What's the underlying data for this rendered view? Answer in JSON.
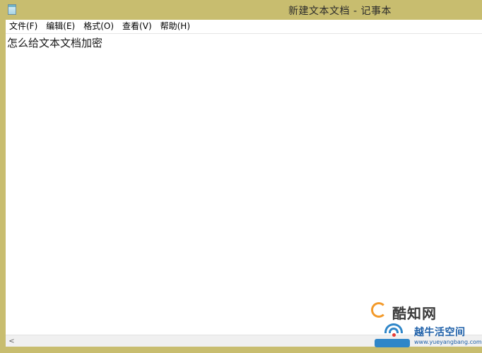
{
  "window": {
    "title": "新建文本文档 - 记事本",
    "icon": "notepad-icon"
  },
  "menubar": {
    "items": [
      {
        "label": "文件(F)"
      },
      {
        "label": "编辑(E)"
      },
      {
        "label": "格式(O)"
      },
      {
        "label": "查看(V)"
      },
      {
        "label": "帮助(H)"
      }
    ]
  },
  "editor": {
    "content": "怎么给文本文档加密"
  },
  "scrollbar": {
    "left_arrow": "<"
  },
  "watermarks": {
    "site1": "酷知网",
    "site2": "越牛活空间",
    "site2_url": "www.yueyangbang.com"
  },
  "colors": {
    "frame": "#c8bd6f",
    "editor_bg": "#ffffff",
    "menubar_bg": "#ffffff",
    "watermark_orange": "#f39a2a",
    "watermark_blue": "#2f86c8"
  }
}
